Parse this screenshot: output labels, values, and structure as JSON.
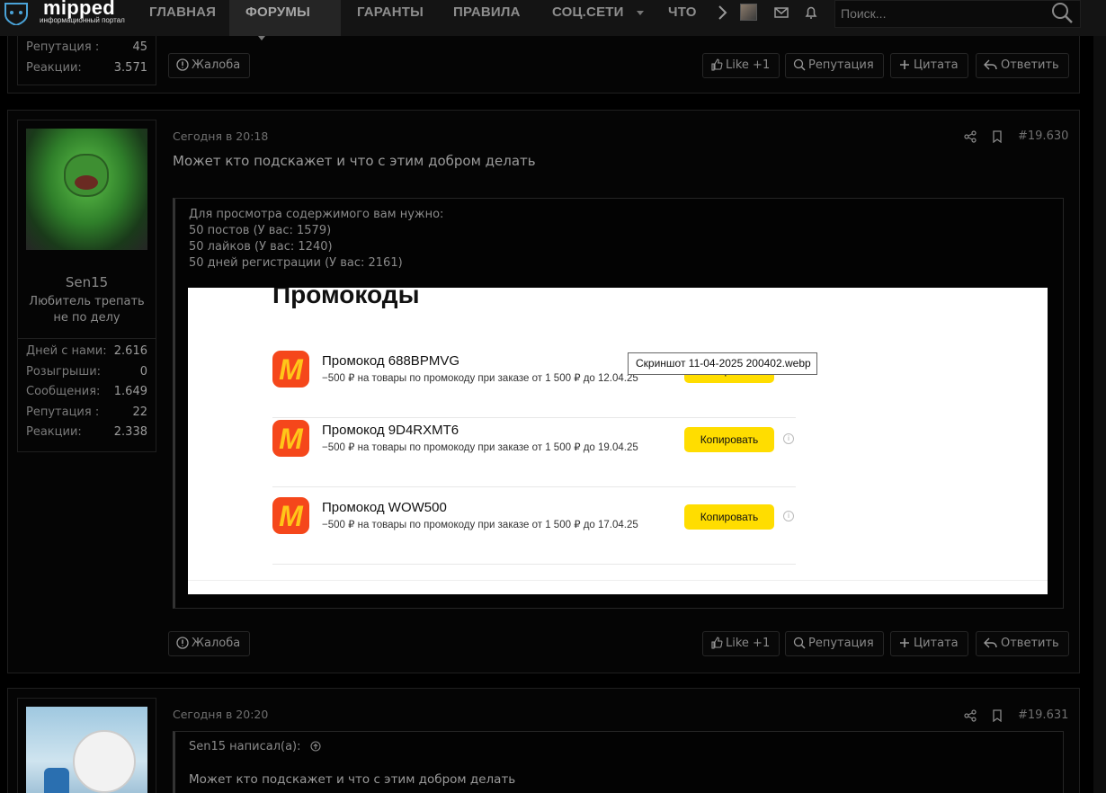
{
  "nav": {
    "brand": "mipped",
    "brand_sub": "информационный портал",
    "items": [
      "ГЛАВНАЯ",
      "ФОРУМЫ",
      "ГАРАНТЫ",
      "ПРАВИЛА",
      "СОЦ.СЕТИ",
      "ЧТО"
    ],
    "search_placeholder": "Поиск..."
  },
  "prev_post": {
    "stats": [
      {
        "label": "Репутация :",
        "value": "45"
      },
      {
        "label": "Реакции:",
        "value": "3.571"
      }
    ]
  },
  "actions": {
    "report": "Жалоба",
    "like": "Like +1",
    "reputation": "Репутация",
    "quote": "Цитата",
    "reply": "Ответить"
  },
  "post1": {
    "time": "Сегодня в 20:18",
    "number": "#19.630",
    "message": "Может кто подскажет и что с этим добром делать",
    "username": "Sen15",
    "user_title": "Любитель трепать не по делу",
    "stats": [
      {
        "label": "Дней с нами:",
        "value": "2.616"
      },
      {
        "label": "Розыгрыши:",
        "value": "0"
      },
      {
        "label": "Сообщения:",
        "value": "1.649"
      },
      {
        "label": "Репутация :",
        "value": "22"
      },
      {
        "label": "Реакции:",
        "value": "2.338"
      }
    ],
    "hidden": {
      "header": "Для просмотра содержимого вам нужно:",
      "reqs": [
        "50 постов (У вас: 1579)",
        "50 лайков (У вас: 1240)",
        "50 дней регистрации (У вас: 2161)"
      ]
    },
    "image": {
      "title": "Промокоды",
      "tooltip": "Скриншот 11-04-2025 200402.webp",
      "logo_letter": "М",
      "copy_label": "Копировать",
      "info_glyph": "i",
      "promos": [
        {
          "title": "Промокод 688BPMVG",
          "desc": "−500 ₽ на товары по промокоду при заказе от 1 500 ₽ до 12.04.25"
        },
        {
          "title": "Промокод 9D4RXMT6",
          "desc": "−500 ₽ на товары по промокоду при заказе от 1 500 ₽ до 19.04.25"
        },
        {
          "title": "Промокод WOW500",
          "desc": "−500 ₽ на товары по промокоду при заказе от 1 500 ₽ до 17.04.25"
        }
      ]
    }
  },
  "post2": {
    "time": "Сегодня в 20:20",
    "number": "#19.631",
    "quote_author": "Sen15 написал(а):",
    "quote_text": "Может кто подскажет и что с этим добром делать"
  },
  "colors": {
    "accent_yellow": "#ffdd00",
    "market_red": "#f5471b",
    "market_yellow": "#ffc619"
  }
}
